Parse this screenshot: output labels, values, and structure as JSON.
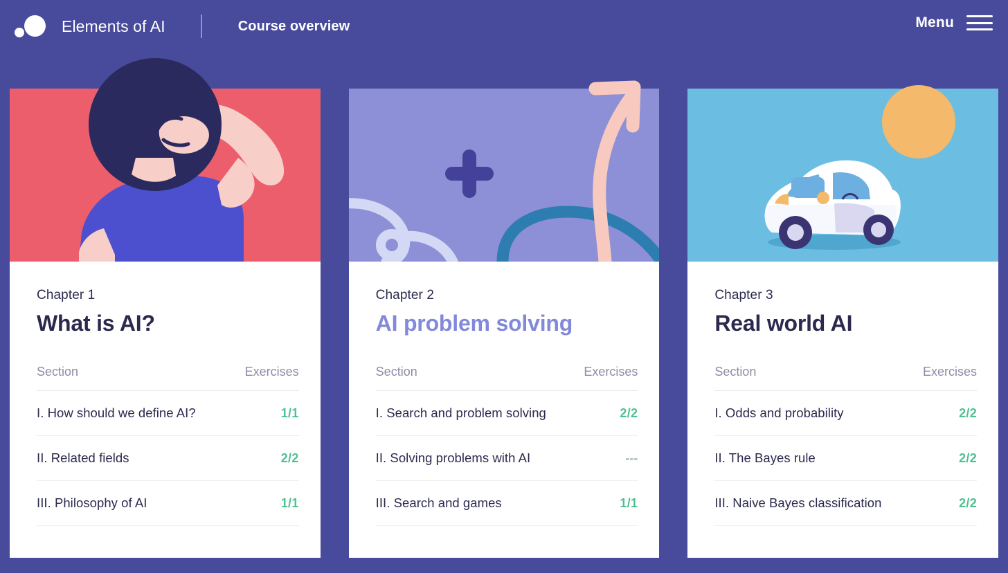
{
  "header": {
    "brand": "Elements of AI",
    "subtitle": "Course overview",
    "menu_label": "Menu",
    "logo_icon": "two-circles-logo",
    "menu_icon": "hamburger-icon"
  },
  "colors": {
    "page_background": "#484A9B",
    "card_background": "#FFFFFF",
    "text_dark": "#2B2A4E",
    "accent_purple": "#8289DB",
    "progress_green": "#4FC091",
    "muted_gray": "#8C8CA6",
    "card1_illustration": "#EC5E6C",
    "card2_illustration": "#8D90D6",
    "card3_illustration": "#6CBDE2"
  },
  "table_headers": {
    "section": "Section",
    "exercises": "Exercises"
  },
  "cards": [
    {
      "chapter_label": "Chapter 1",
      "title": "What is AI?",
      "title_accent": false,
      "illustration": "person-scratching-head",
      "sections": [
        {
          "name": "I. How should we define AI?",
          "count": "1/1",
          "complete": true
        },
        {
          "name": "II. Related fields",
          "count": "2/2",
          "complete": true
        },
        {
          "name": "III. Philosophy of AI",
          "count": "1/1",
          "complete": true
        }
      ]
    },
    {
      "chapter_label": "Chapter 2",
      "title": "AI problem solving",
      "title_accent": true,
      "illustration": "arrow-plus-paths",
      "sections": [
        {
          "name": "I. Search and problem solving",
          "count": "2/2",
          "complete": true
        },
        {
          "name": "II. Solving problems with AI",
          "count": "---",
          "complete": false
        },
        {
          "name": "III. Search and games",
          "count": "1/1",
          "complete": true
        }
      ]
    },
    {
      "chapter_label": "Chapter 3",
      "title": "Real world AI",
      "title_accent": false,
      "illustration": "self-driving-car-sun",
      "sections": [
        {
          "name": "I. Odds and probability",
          "count": "2/2",
          "complete": true
        },
        {
          "name": "II. The Bayes rule",
          "count": "2/2",
          "complete": true
        },
        {
          "name": "III. Naive Bayes classification",
          "count": "2/2",
          "complete": true
        }
      ]
    }
  ]
}
